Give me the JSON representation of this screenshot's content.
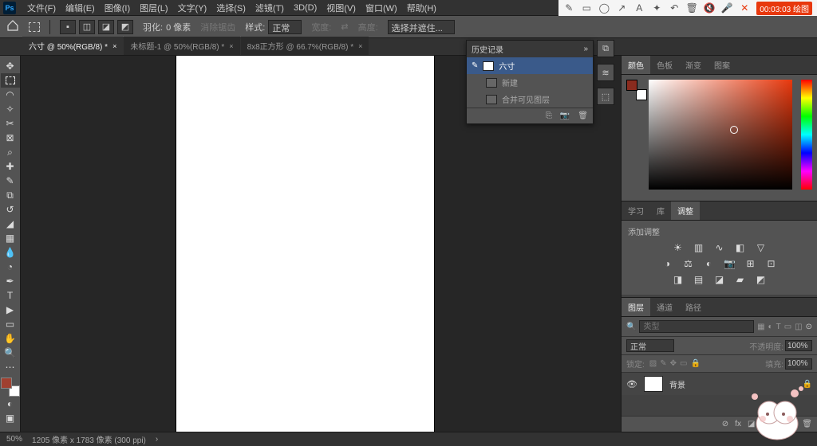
{
  "menubar": {
    "items": [
      "文件(F)",
      "编辑(E)",
      "图像(I)",
      "图层(L)",
      "文字(Y)",
      "选择(S)",
      "滤镜(T)",
      "3D(D)",
      "视图(V)",
      "窗口(W)",
      "帮助(H)"
    ]
  },
  "rec": {
    "timer": "00:03:03 绘图"
  },
  "options": {
    "feather_label": "羽化:",
    "feather_value": "0 像素",
    "antialias": "消除锯齿",
    "style_label": "样式:",
    "style_value": "正常",
    "width_label": "宽度:",
    "height_label": "高度:",
    "select_mask": "选择并遮住..."
  },
  "tabs": [
    {
      "label": "六寸 @ 50%(RGB/8) *",
      "active": true
    },
    {
      "label": "未标题-1 @ 50%(RGB/8) *",
      "active": false
    },
    {
      "label": "8x8正方形 @ 66.7%(RGB/8) *",
      "active": false
    }
  ],
  "history": {
    "title": "历史记录",
    "rows": [
      {
        "label": "六寸",
        "active": true,
        "dim": false
      },
      {
        "label": "新建",
        "active": false,
        "dim": true
      },
      {
        "label": "合并可见图层",
        "active": false,
        "dim": true
      }
    ]
  },
  "color_panel": {
    "tabs": [
      "颜色",
      "色板",
      "渐变",
      "图案"
    ],
    "active_tab": 0
  },
  "mid_panel": {
    "tabs": [
      "学习",
      "库",
      "调整"
    ],
    "active_tab": 2,
    "adj_label": "添加调整"
  },
  "layers_panel": {
    "tabs": [
      "图层",
      "通道",
      "路径"
    ],
    "active_tab": 0,
    "search_placeholder": "类型",
    "blend_mode": "正常",
    "opacity_label": "不透明度:",
    "opacity_value": "100%",
    "lock_label": "锁定:",
    "fill_label": "填充:",
    "fill_value": "100%",
    "layer_name": "背景"
  },
  "status": {
    "zoom": "50%",
    "doc_info": "1205 像素 x 1783 像素 (300 ppi)"
  }
}
